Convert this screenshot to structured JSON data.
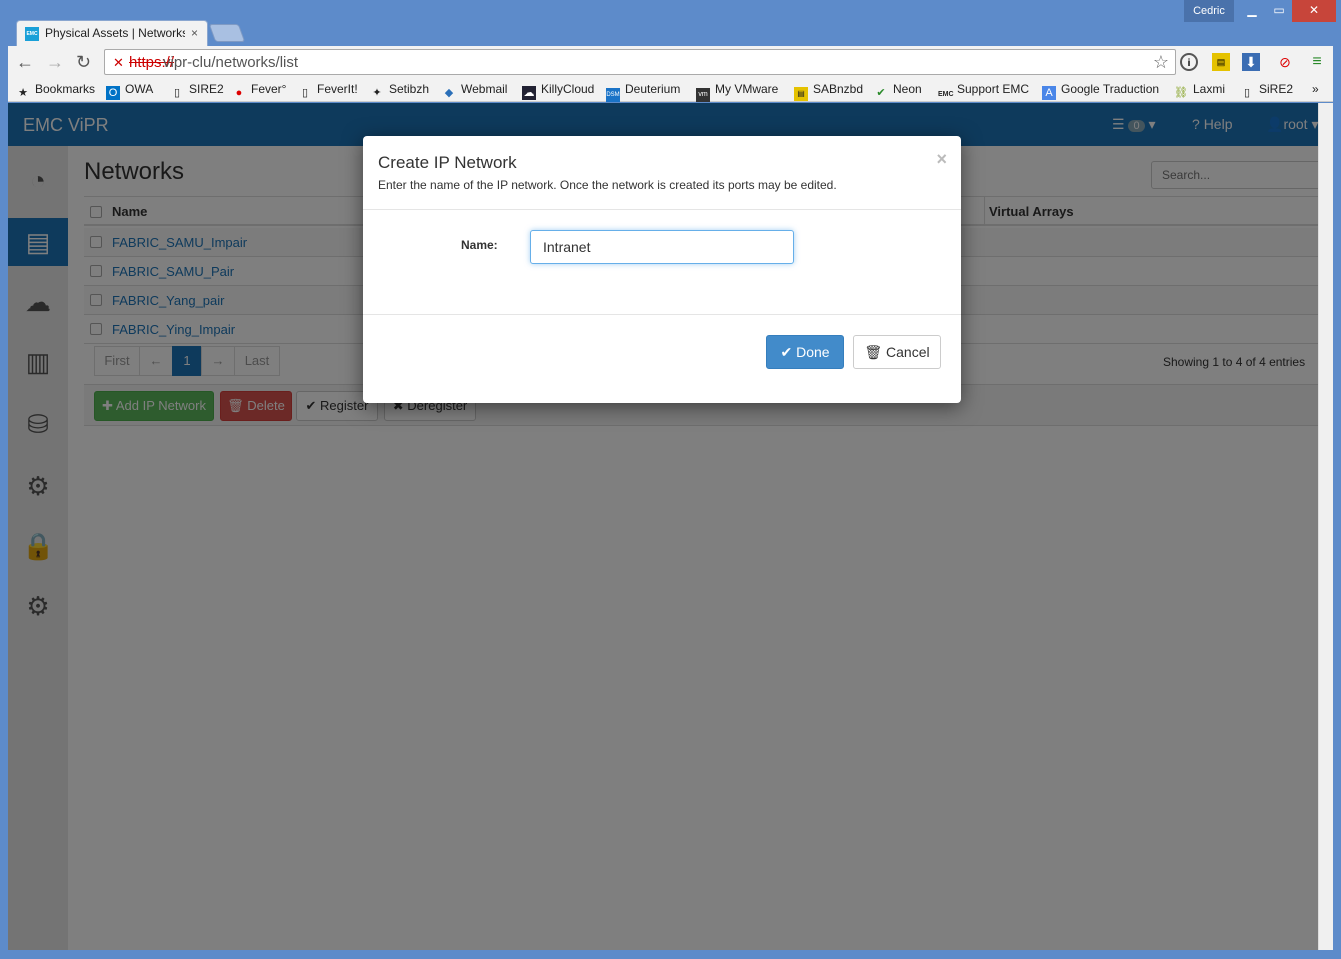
{
  "browser": {
    "tab_title": "Physical Assets | Networks",
    "tab_close": "×",
    "user": "Cedric",
    "url_scheme": "https://",
    "url_rest": "vipr-clu/networks/list",
    "bookmarks": [
      "Bookmarks",
      "OWA",
      "SIRE2",
      "Fever°",
      "FeverIt!",
      "Setibzh",
      "Webmail",
      "KillyCloud",
      "Deuterium",
      "My VMware",
      "SABnzbd",
      "Neon",
      "Support EMC",
      "Google Traduction",
      "Laxmi",
      "SiRE2"
    ],
    "bookmarks_overflow": "»"
  },
  "app": {
    "brand": "EMC ViPR",
    "notifications_count": "0",
    "help_label": "Help",
    "user_label": "root",
    "page_title": "Networks",
    "search_placeholder": "Search...",
    "columns": {
      "name": "Name",
      "virtual_arrays": "Virtual Arrays"
    },
    "rows": [
      "FABRIC_SAMU_Impair",
      "FABRIC_SAMU_Pair",
      "FABRIC_Yang_pair",
      "FABRIC_Ying_Impair"
    ],
    "pager": {
      "first": "First",
      "prev": "←",
      "page": "1",
      "next": "→",
      "last": "Last"
    },
    "showing": "Showing 1 to 4 of 4 entries",
    "buttons": {
      "add": "Add IP Network",
      "delete": "Delete",
      "register": "Register",
      "deregister": "Deregister"
    }
  },
  "modal": {
    "title": "Create IP Network",
    "subtitle": "Enter the name of the IP network. Once the network is created its ports may be edited.",
    "close": "×",
    "name_label": "Name:",
    "name_value": "Intranet",
    "done_label": "Done",
    "cancel_label": "Cancel"
  },
  "colors": {
    "accent": "#1d74b8",
    "primary_button": "#428bca",
    "add_button": "#5cb85c",
    "delete_button": "#d9534f"
  }
}
